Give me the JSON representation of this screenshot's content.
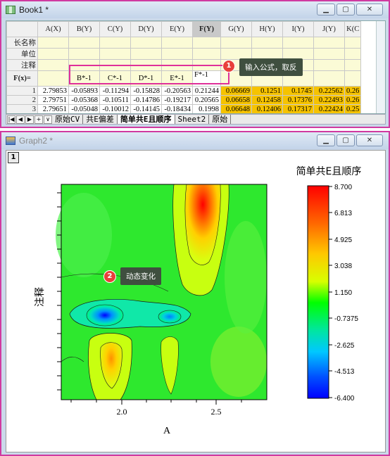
{
  "book": {
    "title": "Book1 *",
    "columns": [
      "A(X)",
      "B(Y)",
      "C(Y)",
      "D(Y)",
      "E(Y)",
      "F(Y)",
      "G(Y)",
      "H(Y)",
      "I(Y)",
      "J(Y)",
      "K(C"
    ],
    "label_rows": [
      "长名称",
      "单位",
      "注释",
      "F(x)="
    ],
    "formulas": [
      "B*-1",
      "C*-1",
      "D*-1",
      "E*-1",
      "F*-1"
    ],
    "rows": [
      {
        "n": "1",
        "cells": [
          "2.79853",
          "-0.05893",
          "-0.11294",
          "-0.15828",
          "-0.20563",
          "0.21244",
          "0.06669",
          "0.1251",
          "0.1745",
          "0.22562",
          "0.26"
        ]
      },
      {
        "n": "2",
        "cells": [
          "2.79751",
          "-0.05368",
          "-0.10511",
          "-0.14786",
          "-0.19217",
          "0.20565",
          "0.06658",
          "0.12458",
          "0.17376",
          "0.22493",
          "0.26"
        ]
      },
      {
        "n": "3",
        "cells": [
          "2.79651",
          "-0.05048",
          "-0.10012",
          "-0.14145",
          "-0.18434",
          "0.1998",
          "0.06648",
          "0.12406",
          "0.17317",
          "0.22424",
          "0.25"
        ]
      }
    ],
    "tabs": [
      "原始CV",
      "共E偏差",
      "简单共E且顺序",
      "Sheet2",
      "原始"
    ],
    "active_tab": "简单共E且顺序",
    "callout": "输入公式，取反",
    "callout_badge": "1"
  },
  "graph": {
    "title": "Graph2 *",
    "page_number": "1",
    "callout": "动态变化",
    "callout_badge": "2",
    "x_axis_label": "A",
    "y_axis_label": "注释",
    "x_ticks": [
      "2.0",
      "2.5"
    ],
    "colorbar_title": "简单共E且顺序",
    "colorbar_labels": [
      "8.700",
      "6.813",
      "4.925",
      "3.038",
      "1.150",
      "-0.7375",
      "-2.625",
      "-4.513",
      "-6.400"
    ]
  },
  "chart_data": {
    "type": "heatmap",
    "title": "简单共E且顺序",
    "xlabel": "A",
    "ylabel": "注释",
    "x_ticks": [
      2.0,
      2.5
    ],
    "zlim": [
      -6.4,
      8.7
    ],
    "colorbar_levels": [
      8.7,
      6.813,
      4.925,
      3.038,
      1.15,
      -0.7375,
      -2.625,
      -4.513,
      -6.4
    ]
  },
  "colors": {
    "accent_pink": "#e0309a",
    "callout_bg": "#3f4f3f",
    "badge_red": "#e8403a",
    "selected_cells": "#f6c300"
  }
}
